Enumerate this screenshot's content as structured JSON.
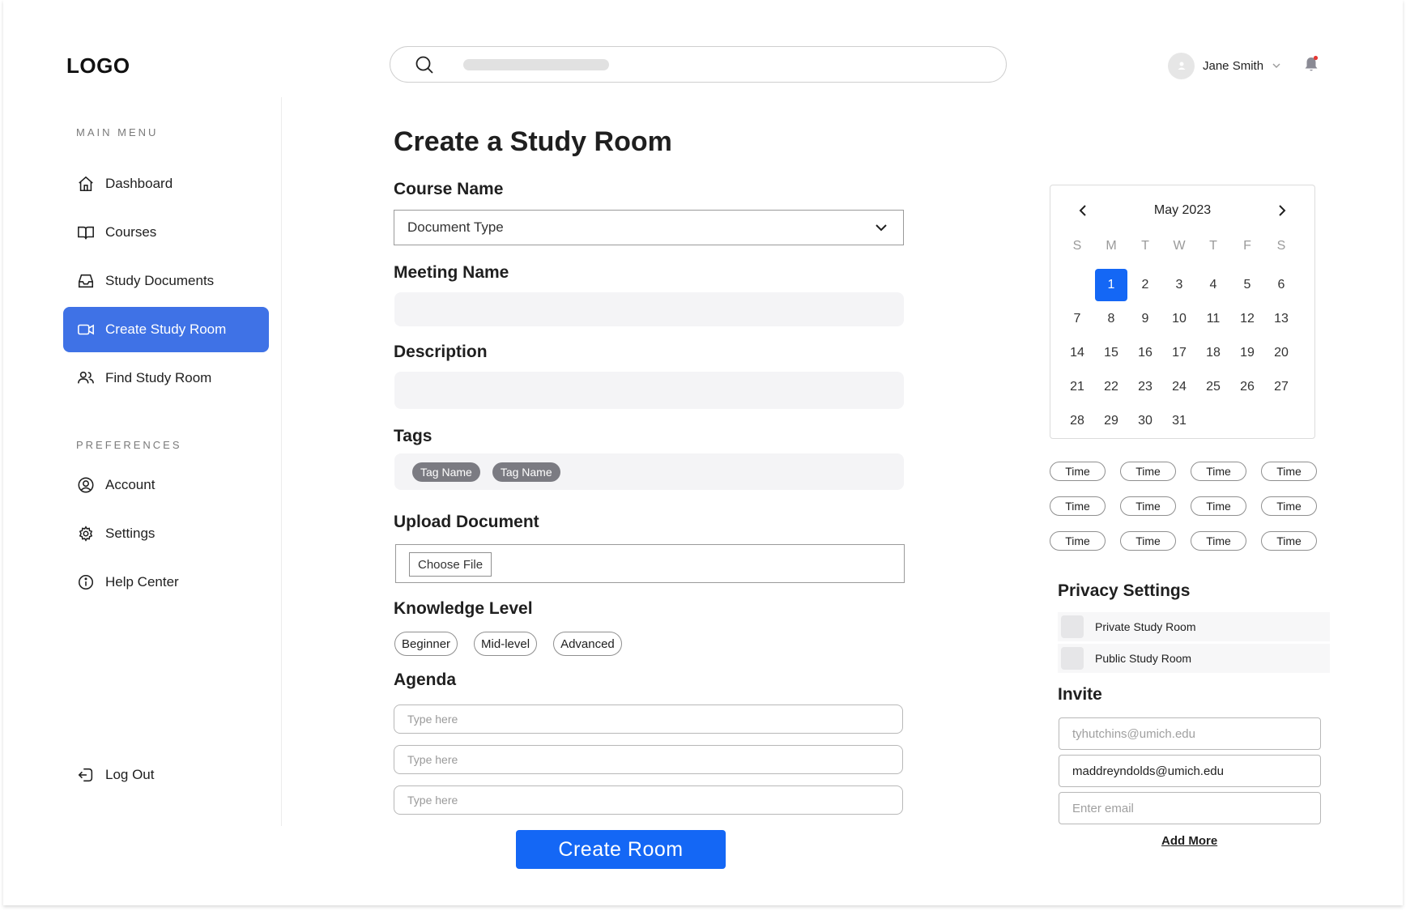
{
  "header": {
    "logo": "LOGO",
    "user_name": "Jane Smith"
  },
  "sidebar": {
    "main_menu_label": "MAIN MENU",
    "preferences_label": "PREFERENCES",
    "main_items": [
      {
        "label": "Dashboard",
        "icon": "home-icon"
      },
      {
        "label": "Courses",
        "icon": "book-icon"
      },
      {
        "label": "Study Documents",
        "icon": "inbox-icon"
      },
      {
        "label": "Create Study Room",
        "icon": "video-icon",
        "active": true
      },
      {
        "label": "Find Study Room",
        "icon": "users-icon"
      }
    ],
    "preference_items": [
      {
        "label": "Account",
        "icon": "account-icon"
      },
      {
        "label": "Settings",
        "icon": "gear-icon"
      },
      {
        "label": "Help Center",
        "icon": "info-icon"
      }
    ],
    "logout_label": "Log Out"
  },
  "form": {
    "title": "Create a Study Room",
    "course_name_label": "Course Name",
    "course_select_value": "Document Type",
    "meeting_name_label": "Meeting Name",
    "description_label": "Description",
    "tags_label": "Tags",
    "tags": [
      "Tag Name",
      "Tag Name"
    ],
    "upload_label": "Upload Document",
    "choose_file_label": "Choose File",
    "knowledge_label": "Knowledge Level",
    "levels": [
      "Beginner",
      "Mid-level",
      "Advanced"
    ],
    "agenda_label": "Agenda",
    "agenda_placeholders": [
      "Type here",
      "Type here",
      "Type here"
    ],
    "create_button": "Create Room"
  },
  "calendar": {
    "month": "May 2023",
    "weekdays": [
      "S",
      "M",
      "T",
      "W",
      "T",
      "F",
      "S"
    ],
    "start_offset": 1,
    "days": 31,
    "selected_day": 1,
    "accent": "#1467f5"
  },
  "times": [
    "Time",
    "Time",
    "Time",
    "Time",
    "Time",
    "Time",
    "Time",
    "Time",
    "Time",
    "Time",
    "Time",
    "Time"
  ],
  "privacy": {
    "title": "Privacy Settings",
    "options": [
      "Private Study Room",
      "Public Study Room"
    ]
  },
  "invite": {
    "title": "Invite",
    "email_1_placeholder": "tyhutchins@umich.edu",
    "email_2_value": "maddreyndolds@umich.edu",
    "email_3_placeholder": "Enter email",
    "add_more": "Add More"
  },
  "colors": {
    "active_nav": "#3f72e6",
    "primary_button": "#1467f5",
    "tag_bg": "#7b7b82"
  }
}
